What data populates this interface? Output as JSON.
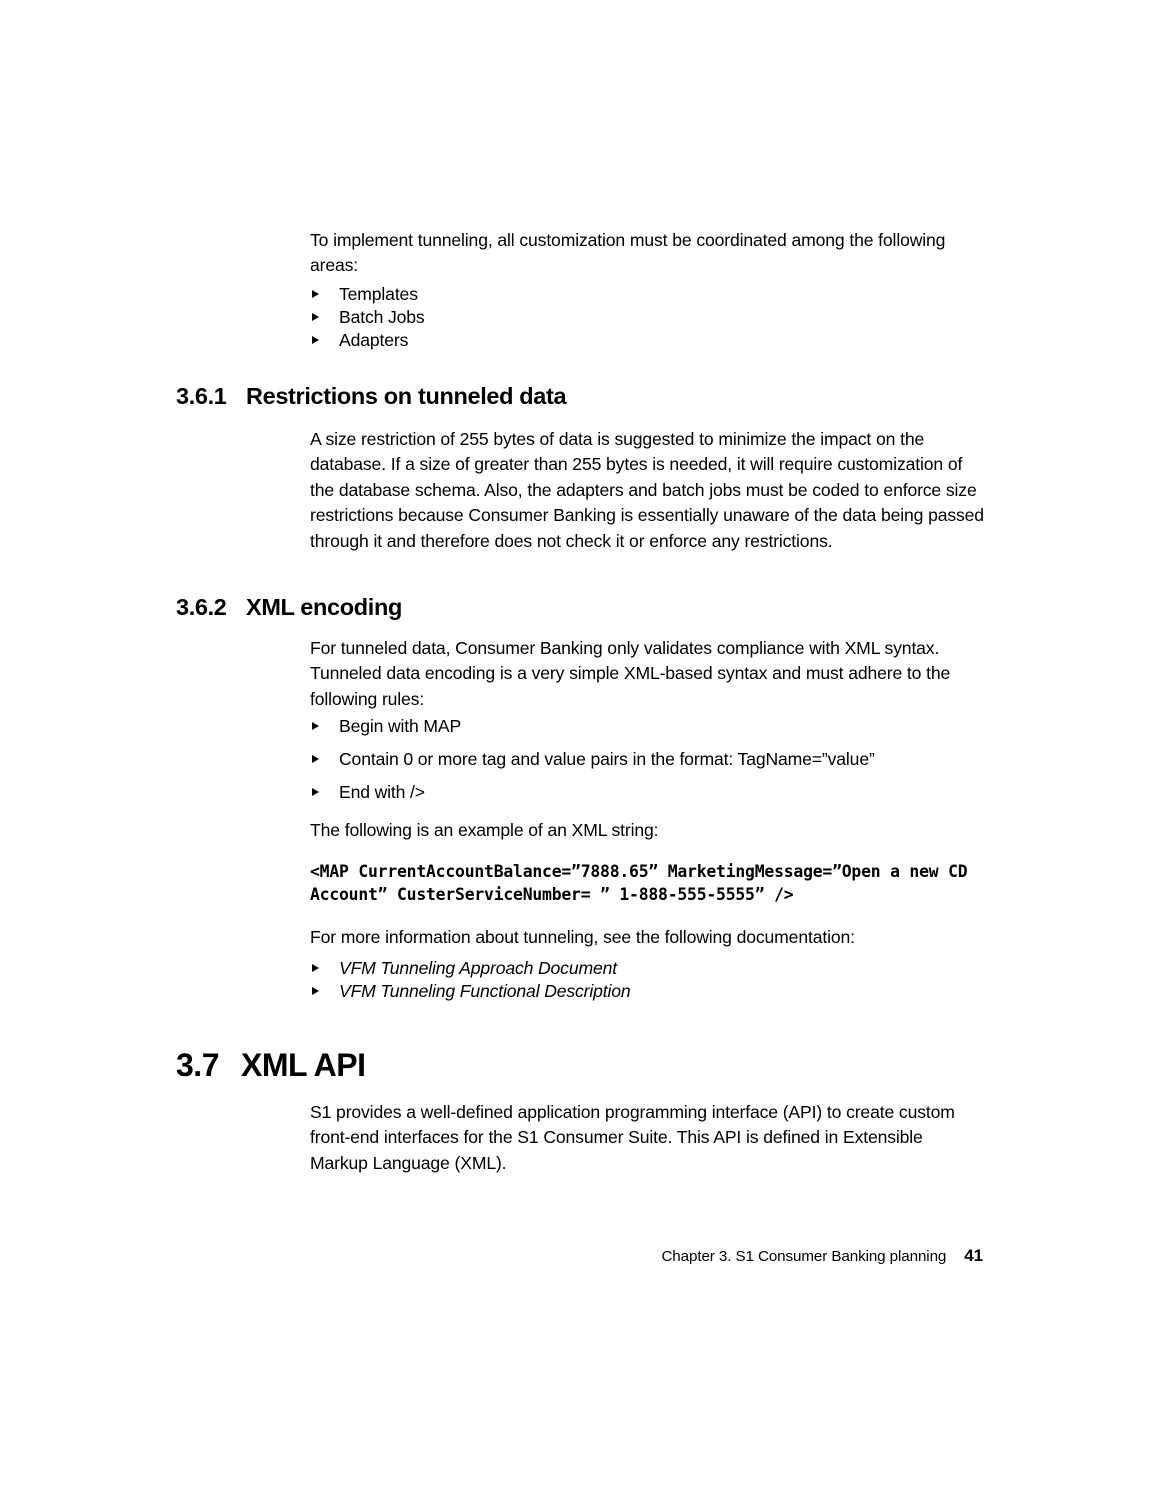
{
  "page": {
    "intro_paragraph": "To implement tunneling, all customization must be coordinated among the following areas:",
    "intro_bullets": [
      {
        "label": "Templates"
      },
      {
        "label": "Batch Jobs"
      },
      {
        "label": "Adapters"
      }
    ],
    "sections": [
      {
        "number": "3.6.1",
        "title": "Restrictions on tunneled data",
        "paragraph": "A size restriction of 255 bytes of data is suggested to minimize the impact on the database. If a size of greater than 255 bytes is needed, it will require customization of the database schema. Also, the adapters and batch jobs must be coded to enforce size restrictions because Consumer Banking is essentially unaware of the data being passed through it and therefore does not check it or enforce any restrictions."
      },
      {
        "number": "3.6.2",
        "title": "XML encoding",
        "paragraph": "For tunneled data, Consumer Banking only validates compliance with XML syntax. Tunneled data encoding is a very simple XML-based syntax and must adhere to the following rules:",
        "rules": [
          {
            "label": "Begin with MAP"
          },
          {
            "label": "Contain 0 or more tag and value pairs in the format: TagName=”value”"
          },
          {
            "label": "End with />"
          }
        ],
        "example_lead": "The following is an example of an XML string:",
        "code_example": "<MAP CurrentAccountBalance=”7888.65” MarketingMessage=”Open a new CD Account” CusterServiceNumber= ” 1-888-555-5555” />",
        "docs_lead": "For more information about tunneling, see the following documentation:",
        "docs": [
          {
            "label": "VFM Tunneling Approach Document"
          },
          {
            "label": "VFM Tunneling Functional Description"
          }
        ]
      },
      {
        "number": "3.7",
        "title": "XML API",
        "paragraph": "S1 provides a well-defined application programming interface (API) to create custom front-end interfaces for the S1 Consumer Suite. This API is defined in Extensible Markup Language (XML)."
      }
    ],
    "footer": {
      "chapter_text": "Chapter 3. S1 Consumer Banking planning",
      "page_number": "41"
    }
  }
}
